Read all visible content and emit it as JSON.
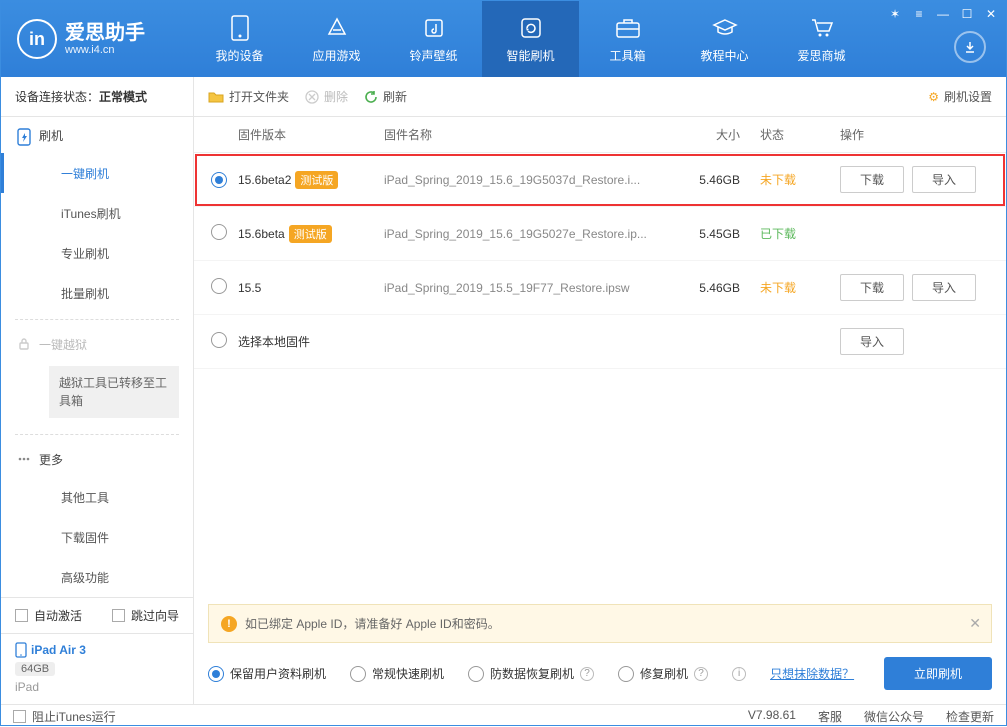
{
  "app": {
    "title": "爱思助手",
    "subtitle": "www.i4.cn",
    "logoLetter": "in"
  },
  "nav": [
    {
      "label": "我的设备"
    },
    {
      "label": "应用游戏"
    },
    {
      "label": "铃声壁纸"
    },
    {
      "label": "智能刷机"
    },
    {
      "label": "工具箱"
    },
    {
      "label": "教程中心"
    },
    {
      "label": "爱思商城"
    }
  ],
  "sidebar": {
    "statusLabel": "设备连接状态：",
    "statusValue": "正常模式",
    "flash": "刷机",
    "items": [
      {
        "label": "一键刷机"
      },
      {
        "label": "iTunes刷机"
      },
      {
        "label": "专业刷机"
      },
      {
        "label": "批量刷机"
      }
    ],
    "jailbreak": "一键越狱",
    "jbNote": "越狱工具已转移至工具箱",
    "more": "更多",
    "moreItems": [
      {
        "label": "其他工具"
      },
      {
        "label": "下载固件"
      },
      {
        "label": "高级功能"
      }
    ],
    "autoActivate": "自动激活",
    "skipGuide": "跳过向导",
    "device": {
      "name": "iPad Air 3",
      "storage": "64GB",
      "type": "iPad"
    }
  },
  "toolbar": {
    "open": "打开文件夹",
    "delete": "删除",
    "refresh": "刷新",
    "settings": "刷机设置"
  },
  "table": {
    "head": {
      "version": "固件版本",
      "name": "固件名称",
      "size": "大小",
      "status": "状态",
      "action": "操作"
    },
    "rows": [
      {
        "selected": true,
        "version": "15.6beta2",
        "tag": "测试版",
        "name": "iPad_Spring_2019_15.6_19G5037d_Restore.i...",
        "size": "5.46GB",
        "status": "未下载",
        "statusClass": "st-orange",
        "download": "下载",
        "import": "导入",
        "highlight": true
      },
      {
        "selected": false,
        "version": "15.6beta",
        "tag": "测试版",
        "name": "iPad_Spring_2019_15.6_19G5027e_Restore.ip...",
        "size": "5.45GB",
        "status": "已下载",
        "statusClass": "st-green"
      },
      {
        "selected": false,
        "version": "15.5",
        "tag": "",
        "name": "iPad_Spring_2019_15.5_19F77_Restore.ipsw",
        "size": "5.46GB",
        "status": "未下载",
        "statusClass": "st-orange",
        "download": "下载",
        "import": "导入"
      },
      {
        "selected": false,
        "version": "",
        "tag": "",
        "name_inplace": "选择本地固件",
        "size": "",
        "status": "",
        "import": "导入"
      }
    ]
  },
  "notice": "如已绑定 Apple ID，请准备好 Apple ID和密码。",
  "options": {
    "o1": "保留用户资料刷机",
    "o2": "常规快速刷机",
    "o3": "防数据恢复刷机",
    "o4": "修复刷机",
    "eraseLink": "只想抹除数据？",
    "flashNow": "立即刷机"
  },
  "statusbar": {
    "blockItunes": "阻止iTunes运行",
    "version": "V7.98.61",
    "service": "客服",
    "wechat": "微信公众号",
    "update": "检查更新"
  }
}
